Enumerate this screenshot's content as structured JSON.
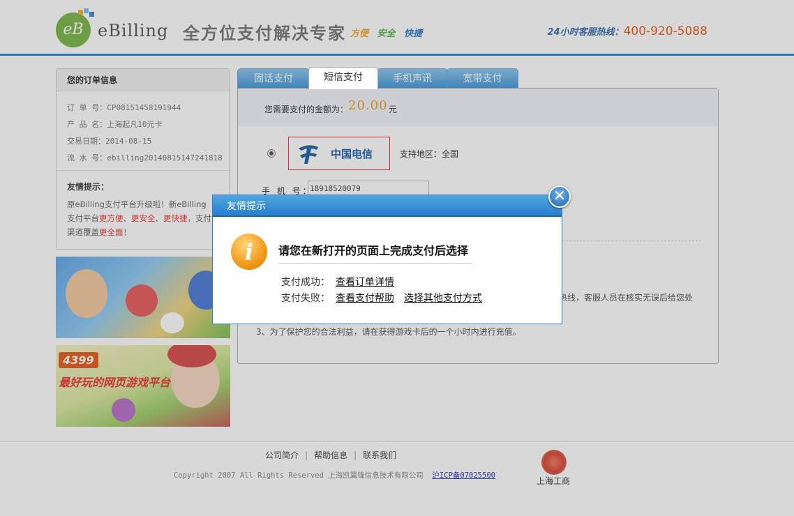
{
  "header": {
    "logo_mark": "eB",
    "logo_text": "eBilling",
    "slogan": "全方位支付解决专家",
    "tags": [
      "方便",
      "安全",
      "快捷"
    ],
    "tag_colors": [
      "#f0a81e",
      "#56b848",
      "#2f78c8"
    ],
    "hotline_label": "24小时客服热线：",
    "hotline_number": "400-920-5088",
    "accent_color": "#2a8ad8"
  },
  "order": {
    "title": "您的订单信息",
    "rows": [
      "订 单 号：CP08151458191944",
      "产 品 名：上海起凡10元卡",
      "交易日期：2014-08-15",
      "流 水 号：ebilling20140815147241818"
    ],
    "tip_title": "友情提示：",
    "tip_segments": [
      "原eBilling支付平台升级啦！新eBilling",
      "支付平台",
      "更方便",
      "、",
      "更安全",
      "、",
      "更快捷",
      "，支付",
      "渠道覆盖",
      "更全面",
      "！"
    ]
  },
  "banners": {
    "banner2_logo": "4399",
    "banner2_text": "最好玩的网页游戏平台"
  },
  "tabs": [
    "固话支付",
    "短信支付",
    "手机声讯",
    "宽带支付"
  ],
  "payment": {
    "amount_label": "您需要支付的金额为：",
    "amount": "20.00",
    "unit": "元",
    "carrier": "中国电信",
    "region": "支持地区：全国",
    "phone_label": "手 机 号：",
    "phone_value": "18918520079",
    "note2_tail": "热线，客服人员在核实无误后给您处",
    "note3": "3、为了保护您的合法利益，请在获得游戏卡后的一个小时内进行充值。"
  },
  "dialog": {
    "title": "友情提示",
    "close_glyph": "✕",
    "icon_glyph": "i",
    "heading": "请您在新打开的页面上完成支付后选择",
    "success_label": "支付成功：",
    "success_link": "查看订单详情",
    "fail_label": "支付失败：",
    "fail_link": "查看支付帮助",
    "other_link": "选择其他支付方式"
  },
  "footer": {
    "links": [
      "公司简介",
      "帮助信息",
      "联系我们"
    ],
    "copyright": "Copyright 2007 All Rights Reserved 上海凯翼锋信息技术有限公司",
    "icp": "沪ICP备07025500",
    "badge_label": "上海工商"
  }
}
